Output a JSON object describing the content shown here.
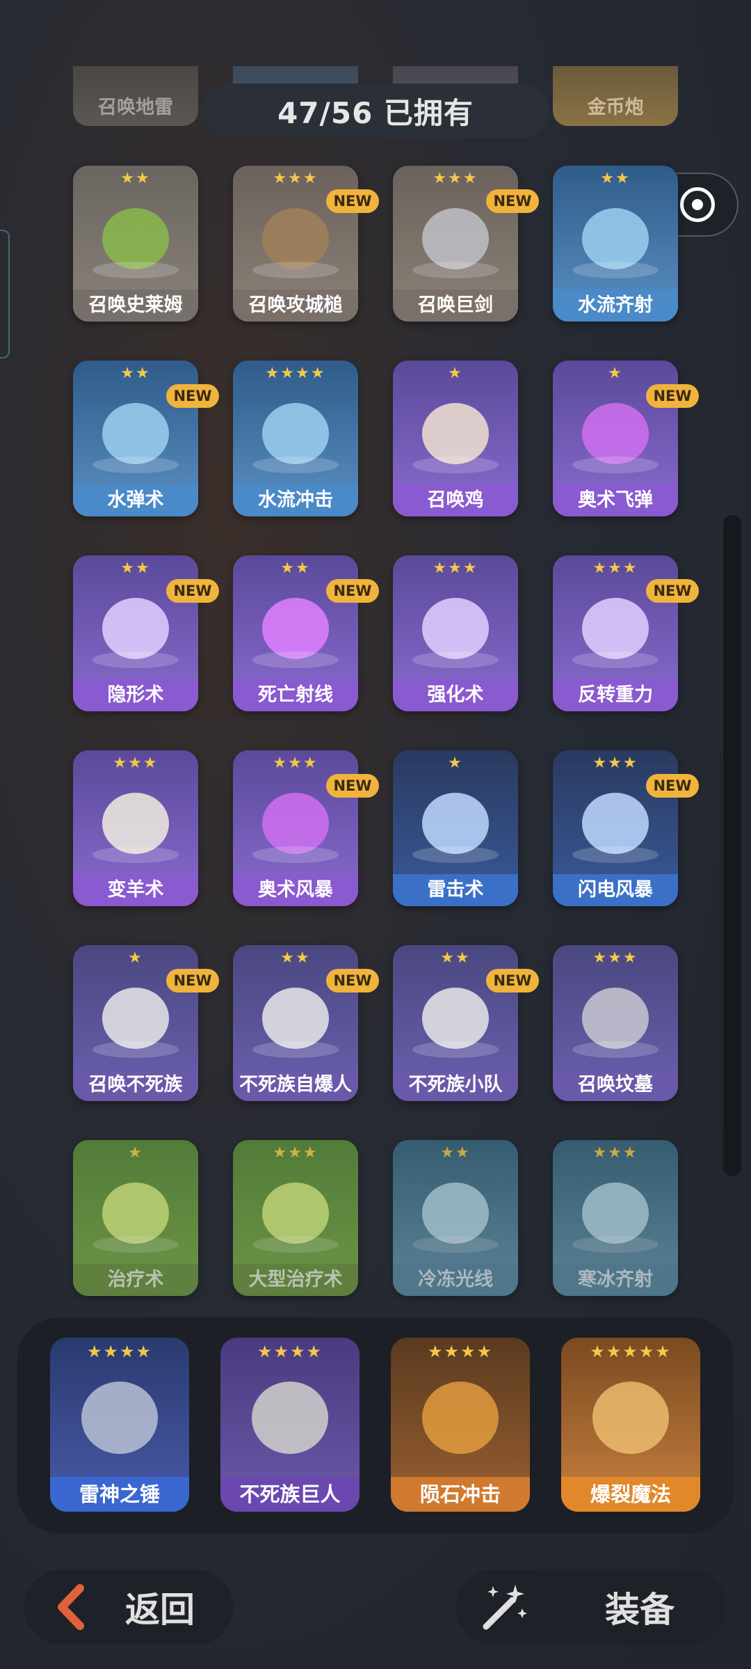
{
  "header": {
    "owned_text": "47/56 已拥有",
    "partial_cards": [
      "召唤地雷",
      "金币炮"
    ]
  },
  "colors": {
    "star": "#f5c84a",
    "new_badge": "#f0b43c",
    "background": "#262a33"
  },
  "cards": [
    {
      "name": "召唤史莱姆",
      "stars": "★★",
      "new": false
    },
    {
      "name": "召唤攻城槌",
      "stars": "★★★",
      "new": true
    },
    {
      "name": "召唤巨剑",
      "stars": "★★★",
      "new": true
    },
    {
      "name": "水流齐射",
      "stars": "★★",
      "new": false
    },
    {
      "name": "水弹术",
      "stars": "★★",
      "new": true
    },
    {
      "name": "水流冲击",
      "stars": "★★★★",
      "new": false
    },
    {
      "name": "召唤鸡",
      "stars": "★",
      "new": false
    },
    {
      "name": "奥术飞弹",
      "stars": "★",
      "new": true
    },
    {
      "name": "隐形术",
      "stars": "★★",
      "new": true
    },
    {
      "name": "死亡射线",
      "stars": "★★",
      "new": true
    },
    {
      "name": "强化术",
      "stars": "★★★",
      "new": false
    },
    {
      "name": "反转重力",
      "stars": "★★★",
      "new": true
    },
    {
      "name": "变羊术",
      "stars": "★★★",
      "new": false
    },
    {
      "name": "奥术风暴",
      "stars": "★★★",
      "new": true
    },
    {
      "name": "雷击术",
      "stars": "★",
      "new": false
    },
    {
      "name": "闪电风暴",
      "stars": "★★★",
      "new": true
    },
    {
      "name": "召唤不死族",
      "stars": "★",
      "new": true
    },
    {
      "name": "不死族自爆人",
      "stars": "★★",
      "new": true
    },
    {
      "name": "不死族小队",
      "stars": "★★",
      "new": true
    },
    {
      "name": "召唤坟墓",
      "stars": "★★★",
      "new": false
    },
    {
      "name": "治疗术",
      "stars": "★",
      "new": false
    },
    {
      "name": "大型治疗术",
      "stars": "★★★",
      "new": false
    },
    {
      "name": "冷冻光线",
      "stars": "★★",
      "new": false
    },
    {
      "name": "寒冰齐射",
      "stars": "★★★",
      "new": false
    }
  ],
  "new_label": "NEW",
  "equipped": [
    {
      "name": "雷神之锤",
      "stars": "★★★★"
    },
    {
      "name": "不死族巨人",
      "stars": "★★★★"
    },
    {
      "name": "陨石冲击",
      "stars": "★★★★"
    },
    {
      "name": "爆裂魔法",
      "stars": "★★★★★"
    }
  ],
  "footer": {
    "back_label": "返回",
    "equip_label": "装备"
  }
}
